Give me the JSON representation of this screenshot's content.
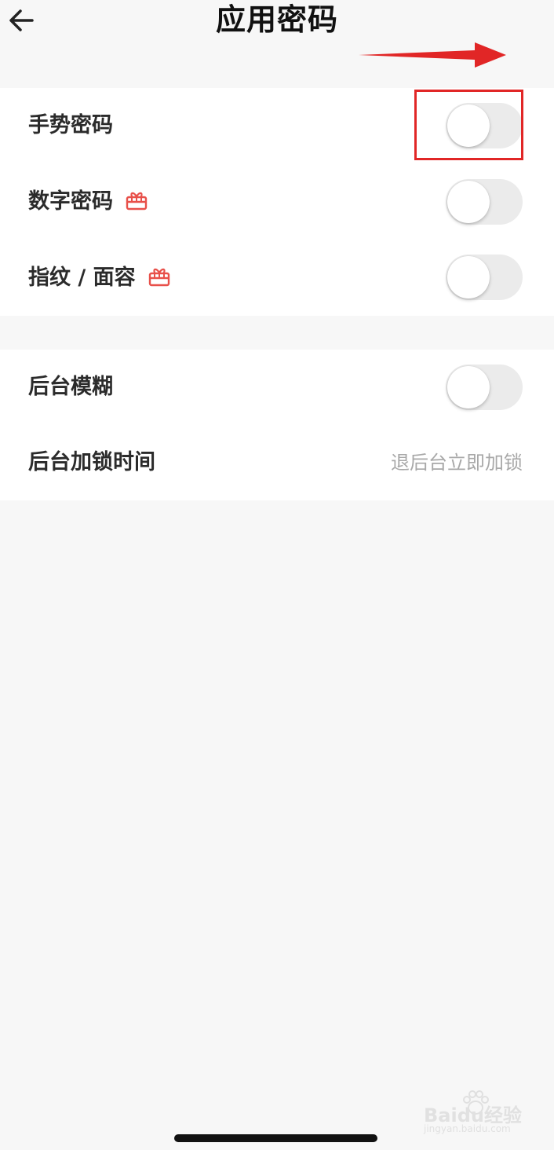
{
  "header": {
    "title": "应用密码"
  },
  "settings_group_1": {
    "items": [
      {
        "label": "手势密码",
        "toggle_on": false,
        "badge_icon": null
      },
      {
        "label": "数字密码",
        "toggle_on": false,
        "badge_icon": "gift-icon"
      },
      {
        "label": "指纹 / 面容",
        "toggle_on": false,
        "badge_icon": "gift-icon"
      }
    ]
  },
  "settings_group_2": {
    "blur_label": "后台模糊",
    "blur_toggle_on": false,
    "lock_time_label": "后台加锁时间",
    "lock_time_value": "退后台立即加锁"
  },
  "annotation": {
    "highlight_color": "#e12626"
  },
  "watermark": {
    "main": "Baidu经验",
    "sub": "jingyan.baidu.com"
  },
  "colors": {
    "accent_badge": "#e8504a",
    "toggle_off": "#ebebeb",
    "background": "#f7f7f7"
  }
}
